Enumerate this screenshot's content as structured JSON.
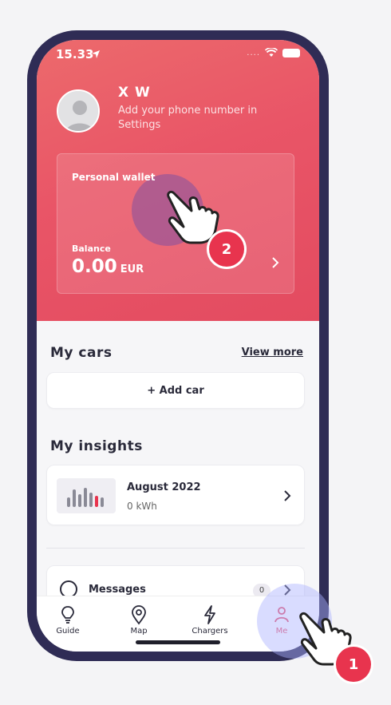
{
  "status_bar": {
    "time": "15.33",
    "dots": "...."
  },
  "profile": {
    "name": "X W",
    "subtitle": "Add your phone number in Settings"
  },
  "wallet": {
    "title": "Personal wallet",
    "balance_label": "Balance",
    "balance_value": "0.00",
    "currency": "EUR"
  },
  "cars": {
    "title": "My cars",
    "view_more": "View more",
    "add_label": "+ Add car"
  },
  "insights": {
    "title": "My insights",
    "month": "August 2022",
    "value": "0 kWh"
  },
  "messages": {
    "label": "Messages",
    "count": "0"
  },
  "tabs": [
    {
      "label": "Guide",
      "icon": "lightbulb-icon"
    },
    {
      "label": "Map",
      "icon": "map-pin-icon"
    },
    {
      "label": "Chargers",
      "icon": "lightning-icon"
    },
    {
      "label": "Me",
      "icon": "person-icon"
    }
  ],
  "step_badges": {
    "step1": "1",
    "step2": "2"
  },
  "colors": {
    "accent": "#E8506A",
    "frame": "#2F2C55",
    "badge": "#E8344E"
  }
}
